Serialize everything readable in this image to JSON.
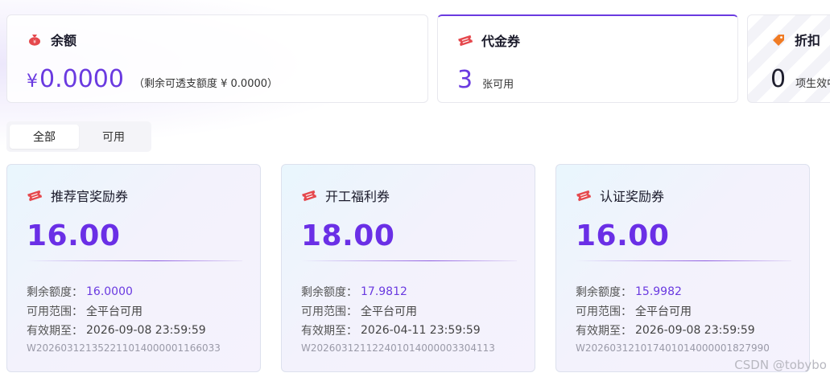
{
  "summary": {
    "balance": {
      "title": "余额",
      "currency_symbol": "¥",
      "amount": "0.0000",
      "note": "（剩余可透支额度 ¥ 0.0000）"
    },
    "vouchers": {
      "title": "代金券",
      "count": "3",
      "unit": "张可用"
    },
    "discount": {
      "title": "折扣",
      "count": "0",
      "unit": "项生效中"
    }
  },
  "tabs": [
    {
      "label": "全部",
      "selected": true
    },
    {
      "label": "可用",
      "selected": false
    }
  ],
  "labels": {
    "remaining": "剩余额度：",
    "scope": "可用范围：",
    "expiry": "有效期至："
  },
  "cards": [
    {
      "name": "推荐官奖励券",
      "amount": "16.00",
      "remaining": "16.0000",
      "scope": "全平台可用",
      "expiry": "2026-09-08 23:59:59",
      "code": "W202603121352211014000001166033"
    },
    {
      "name": "开工福利券",
      "amount": "18.00",
      "remaining": "17.9812",
      "scope": "全平台可用",
      "expiry": "2026-04-11 23:59:59",
      "code": "W202603121122401014000003304113"
    },
    {
      "name": "认证奖励券",
      "amount": "16.00",
      "remaining": "15.9982",
      "scope": "全平台可用",
      "expiry": "2026-09-08 23:59:59",
      "code": "W202603121017401014000001827990"
    }
  ],
  "watermark": "CSDN @tobybo",
  "colors": {
    "accent": "#6a3ae0",
    "voucher_icon": "#e5484d",
    "discount_icon": "#f07b24"
  }
}
